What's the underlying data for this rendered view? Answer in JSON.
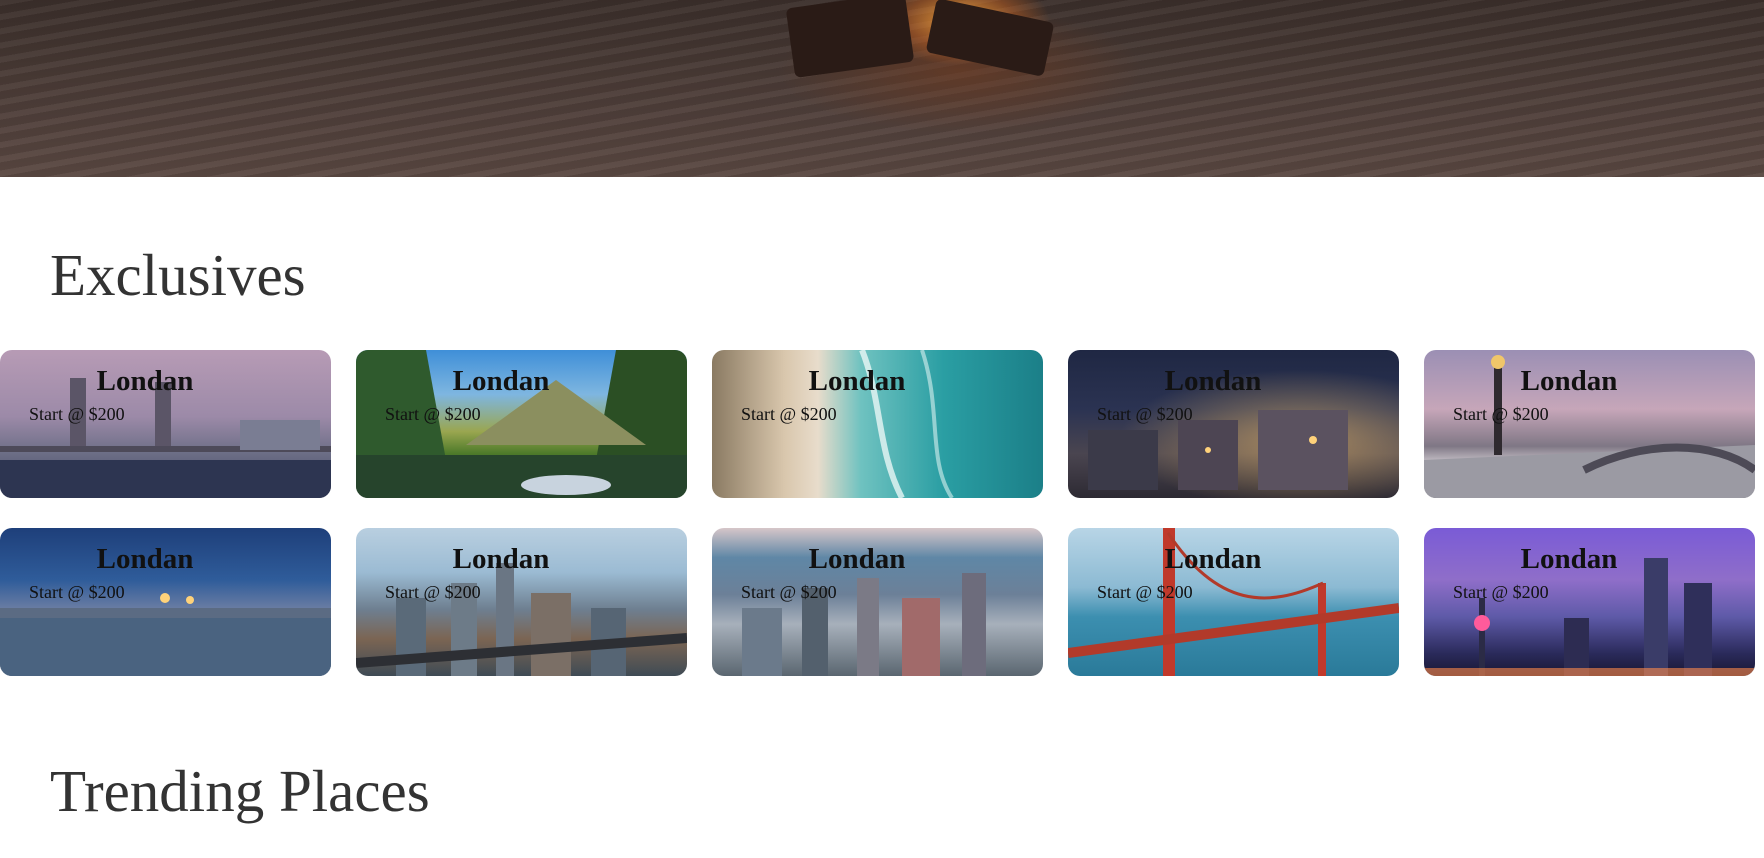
{
  "sections": {
    "exclusives_title": "Exclusives",
    "trending_title": "Trending Places"
  },
  "exclusives": [
    {
      "title": "Londan",
      "price": "Start @ $200"
    },
    {
      "title": "Londan",
      "price": "Start @ $200"
    },
    {
      "title": "Londan",
      "price": "Start @ $200"
    },
    {
      "title": "Londan",
      "price": "Start @ $200"
    },
    {
      "title": "Londan",
      "price": "Start @ $200"
    },
    {
      "title": "Londan",
      "price": "Start @ $200"
    },
    {
      "title": "Londan",
      "price": "Start @ $200"
    },
    {
      "title": "Londan",
      "price": "Start @ $200"
    },
    {
      "title": "Londan",
      "price": "Start @ $200"
    },
    {
      "title": "Londan",
      "price": "Start @ $200"
    }
  ]
}
